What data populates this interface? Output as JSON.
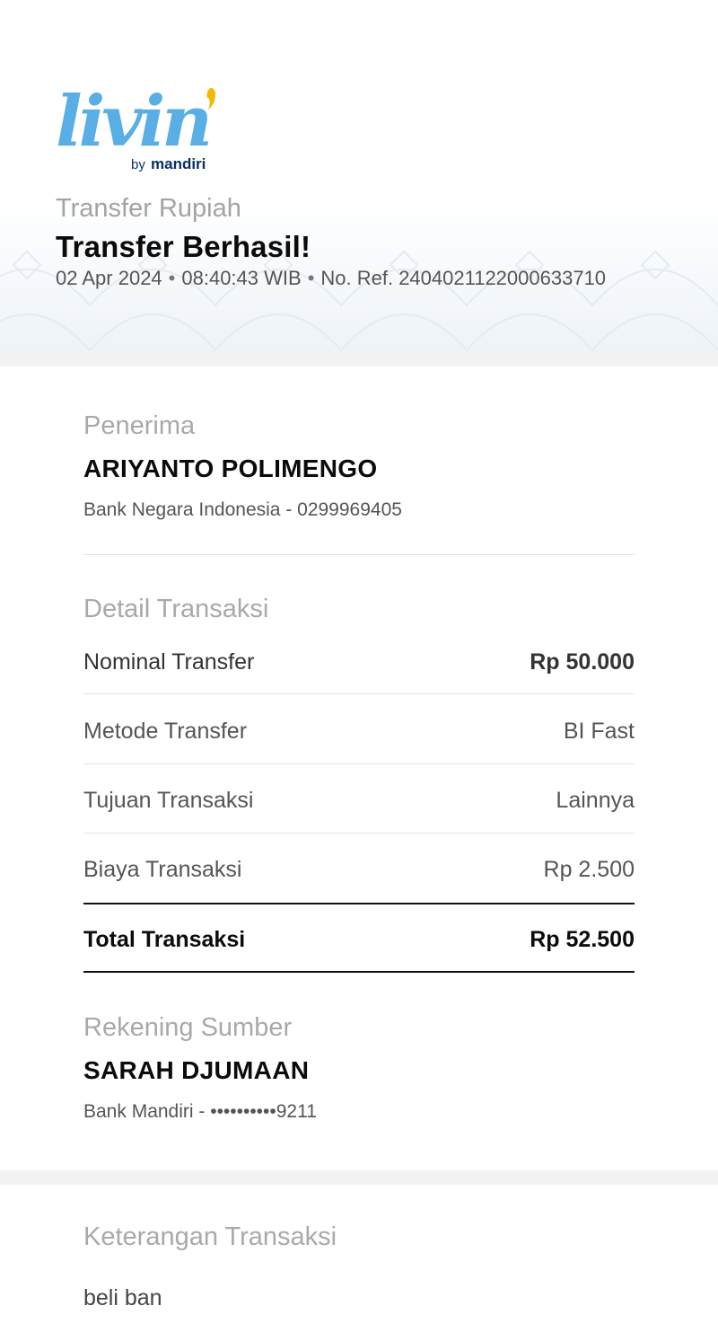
{
  "brand": {
    "logo_text": "livin'",
    "logo_sub": "by mandiri",
    "blue": "#5aaee6",
    "navy": "#0b2f66",
    "yellow": "#f5b800"
  },
  "header": {
    "subtitle": "Transfer Rupiah",
    "title": "Transfer Berhasil!",
    "date": "02 Apr 2024",
    "time": "08:40:43 WIB",
    "reference": "No. Ref. 2404021122000633710"
  },
  "recipient": {
    "label": "Penerima",
    "name": "ARIYANTO POLIMENGO",
    "bank_account": "Bank Negara Indonesia - 0299969405"
  },
  "details": {
    "label": "Detail Transaksi",
    "rows": [
      {
        "label": "Nominal Transfer",
        "value": "Rp 50.000"
      },
      {
        "label": "Metode Transfer",
        "value": "BI Fast"
      },
      {
        "label": "Tujuan Transaksi",
        "value": "Lainnya"
      },
      {
        "label": "Biaya Transaksi",
        "value": "Rp 2.500"
      }
    ],
    "total": {
      "label": "Total Transaksi",
      "value": "Rp 52.500"
    }
  },
  "source": {
    "label": "Rekening Sumber",
    "name": "SARAH DJUMAAN",
    "bank_account": "Bank Mandiri - ••••••••••9211"
  },
  "note": {
    "label": "Keterangan Transaksi",
    "text": "beli ban"
  }
}
